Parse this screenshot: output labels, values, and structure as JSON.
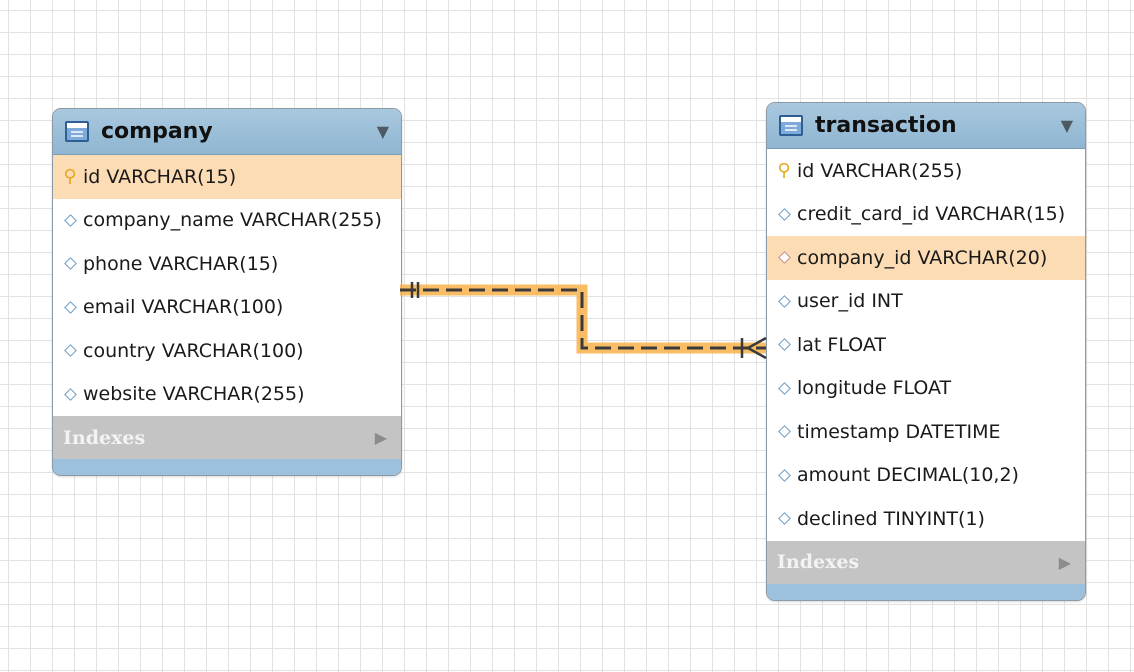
{
  "tables": [
    {
      "name": "company",
      "columns": [
        {
          "text": "id VARCHAR(15)",
          "icon": "primary-key-icon"
        },
        {
          "text": "company_name VARCHAR(255)",
          "icon": "column-diamond-icon"
        },
        {
          "text": "phone VARCHAR(15)",
          "icon": "column-diamond-icon"
        },
        {
          "text": "email VARCHAR(100)",
          "icon": "column-diamond-icon"
        },
        {
          "text": "country VARCHAR(100)",
          "icon": "column-diamond-icon"
        },
        {
          "text": "website VARCHAR(255)",
          "icon": "column-diamond-icon"
        }
      ],
      "indexes_label": "Indexes"
    },
    {
      "name": "transaction",
      "columns": [
        {
          "text": "id VARCHAR(255)",
          "icon": "primary-key-icon"
        },
        {
          "text": "credit_card_id VARCHAR(15)",
          "icon": "column-diamond-icon"
        },
        {
          "text": "company_id VARCHAR(20)",
          "icon": "foreign-key-diamond-icon"
        },
        {
          "text": "user_id INT",
          "icon": "column-diamond-icon"
        },
        {
          "text": "lat FLOAT",
          "icon": "column-diamond-icon"
        },
        {
          "text": "longitude FLOAT",
          "icon": "column-diamond-icon"
        },
        {
          "text": "timestamp DATETIME",
          "icon": "column-diamond-icon"
        },
        {
          "text": "amount DECIMAL(10,2)",
          "icon": "column-diamond-icon"
        },
        {
          "text": "declined TINYINT(1)",
          "icon": "column-diamond-icon"
        }
      ],
      "indexes_label": "Indexes"
    }
  ],
  "relationship": {
    "from_table": "company",
    "to_table": "transaction",
    "from_cardinality": "one-and-only-one",
    "to_cardinality": "one-or-many",
    "highlight_color": "#f8b24a",
    "line_color": "#3a3a3a"
  },
  "colors": {
    "header": "#9dc0dc",
    "highlight_row": "#fcdcb4",
    "indexes_bar": "#c4c4c4"
  }
}
